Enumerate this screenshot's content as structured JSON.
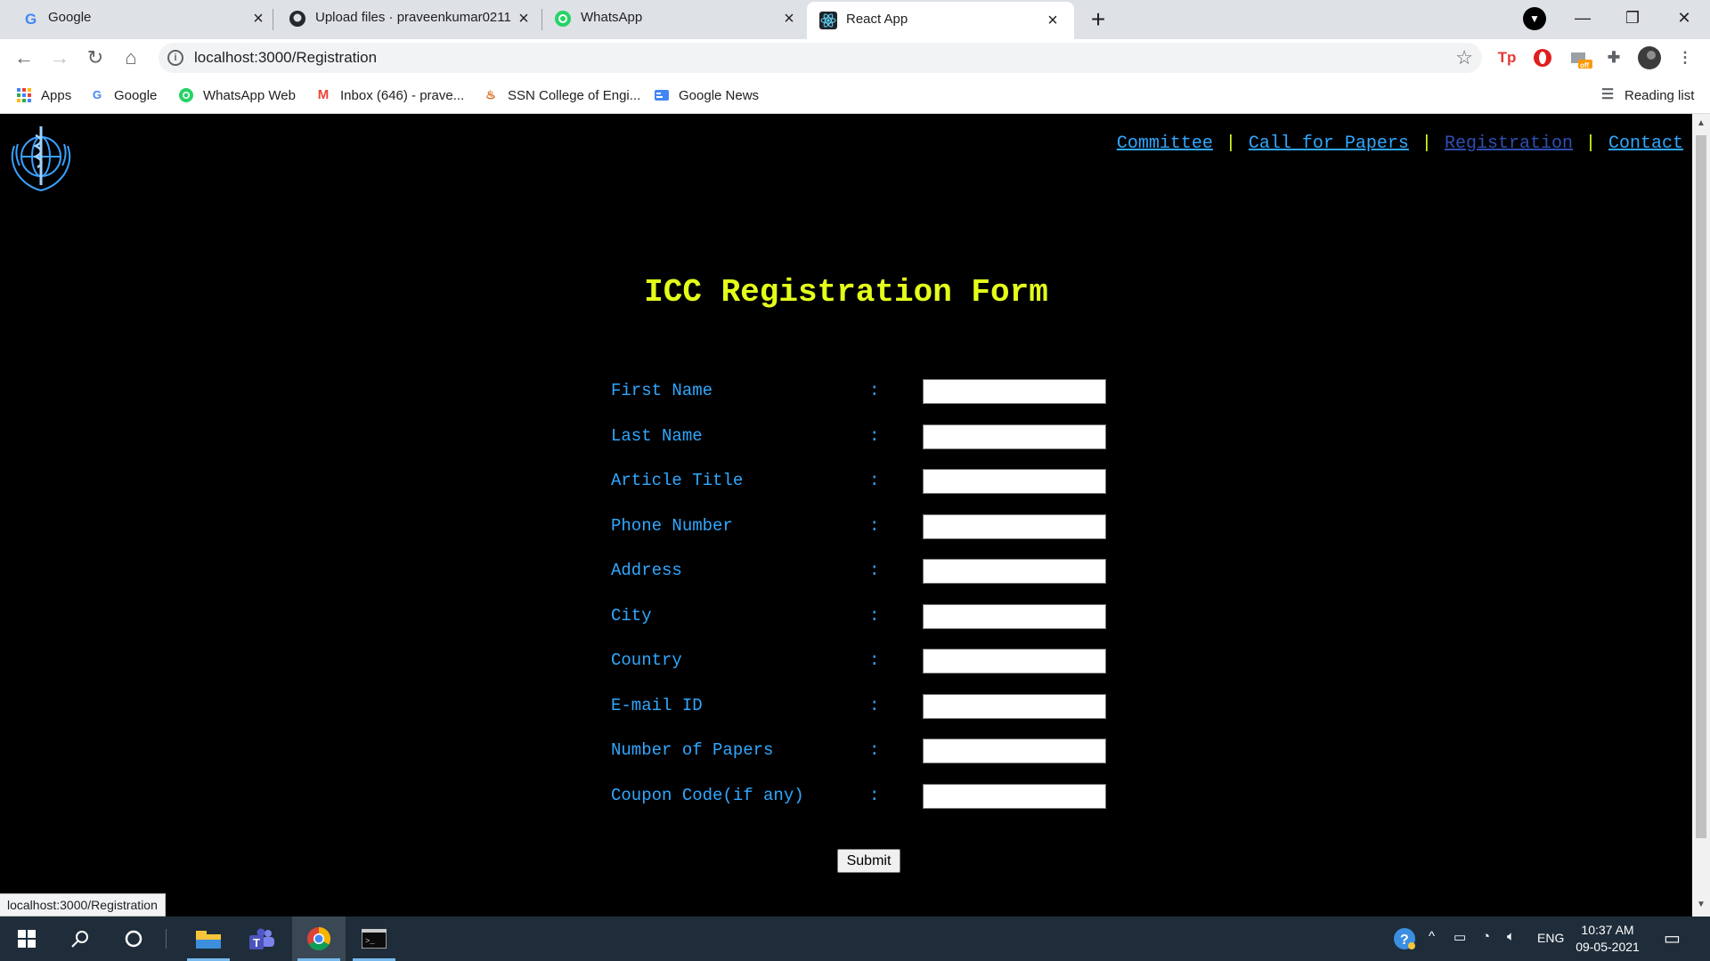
{
  "browser": {
    "tabs": [
      {
        "title": "Google",
        "icon": "google-icon"
      },
      {
        "title": "Upload files · praveenkumar0211",
        "icon": "github-icon"
      },
      {
        "title": "WhatsApp",
        "icon": "whatsapp-icon"
      },
      {
        "title": "React App",
        "icon": "react-icon",
        "active": true
      }
    ],
    "url": "localhost:3000/Registration",
    "bookmarks": [
      {
        "label": "Apps",
        "icon": "apps-grid-icon"
      },
      {
        "label": "Google",
        "icon": "google-icon"
      },
      {
        "label": "WhatsApp Web",
        "icon": "whatsapp-icon"
      },
      {
        "label": "Inbox (646) - prave...",
        "icon": "gmail-icon"
      },
      {
        "label": "SSN College of Engi...",
        "icon": "ssn-icon"
      },
      {
        "label": "Google News",
        "icon": "google-news-icon"
      }
    ],
    "reading_list": "Reading list",
    "extension_badge": "off",
    "status_url": "localhost:3000/Registration"
  },
  "page": {
    "nav": [
      {
        "label": "Committee"
      },
      {
        "label": "Call for Papers"
      },
      {
        "label": "Registration",
        "visited": true
      },
      {
        "label": "Contact"
      }
    ],
    "nav_separator": "|",
    "title": "ICC Registration Form",
    "colon": ":",
    "fields": [
      {
        "label": "First Name",
        "value": ""
      },
      {
        "label": "Last Name",
        "value": ""
      },
      {
        "label": "Article Title",
        "value": ""
      },
      {
        "label": "Phone Number",
        "value": ""
      },
      {
        "label": "Address",
        "value": ""
      },
      {
        "label": "City",
        "value": ""
      },
      {
        "label": "Country",
        "value": ""
      },
      {
        "label": "E-mail ID",
        "value": ""
      },
      {
        "label": "Number of Papers",
        "value": ""
      },
      {
        "label": "Coupon Code(if any)",
        "value": ""
      }
    ],
    "submit_label": "Submit"
  },
  "taskbar": {
    "language": "ENG",
    "time": "10:37 AM",
    "date": "09-05-2021"
  },
  "colors": {
    "title": "#e3ff1a",
    "label": "#31a8ff",
    "background": "#000000"
  }
}
